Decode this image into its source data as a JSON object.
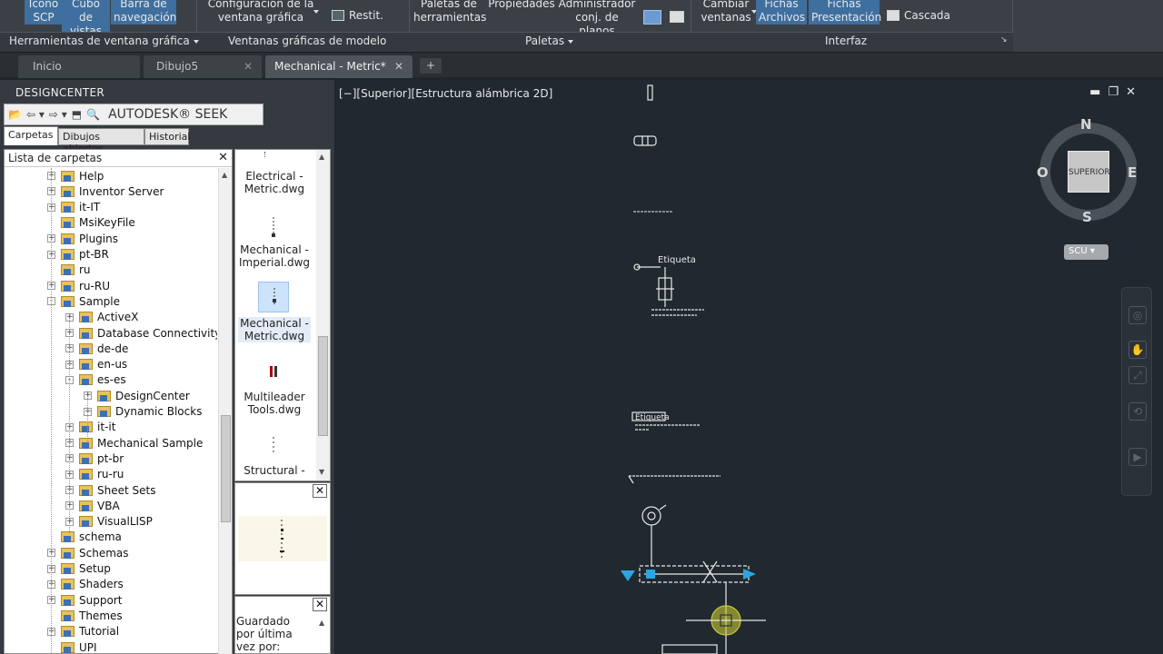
{
  "ribbon": {
    "btn_scp": "Icono SCP",
    "btn_cubo": "Cubo de vistas",
    "btn_barra": "Barra de navegación",
    "btn_config": "Configuración de la ventana gráfica",
    "btn_restit": "Restit.",
    "btn_paletas": "Paletas de herramientas",
    "btn_propiedades": "Propiedades",
    "btn_admin": "Administrador conj. de planos",
    "btn_cambiar": "Cambiar ventanas",
    "btn_fichas_archivos": "Fichas Archivos",
    "btn_fichas_presentacion": "Fichas Presentación",
    "btn_cascada": "Cascada",
    "panel_herramientas": "Herramientas de ventana gráfica",
    "panel_ventanas": "Ventanas gráficas de modelo",
    "panel_paletas": "Paletas",
    "panel_interfaz": "Interfaz"
  },
  "file_tabs": [
    {
      "label": "Inicio"
    },
    {
      "label": "Dibujo5"
    },
    {
      "label": "Mechanical - Metric*"
    }
  ],
  "designcenter": {
    "title": "DESIGNCENTER",
    "seek_label": "AUTODESK® SEEK",
    "tabs": [
      "Carpetas",
      "Dibujos abiertos",
      "Historial"
    ],
    "folder_header": "Lista de carpetas",
    "tree": [
      {
        "label": "Help",
        "level": 0,
        "expand": "+"
      },
      {
        "label": "Inventor Server",
        "level": 0,
        "expand": "+"
      },
      {
        "label": "it-IT",
        "level": 0,
        "expand": "+"
      },
      {
        "label": "MsiKeyFile",
        "level": 0,
        "expand": ""
      },
      {
        "label": "Plugins",
        "level": 0,
        "expand": "+"
      },
      {
        "label": "pt-BR",
        "level": 0,
        "expand": "+"
      },
      {
        "label": "ru",
        "level": 0,
        "expand": ""
      },
      {
        "label": "ru-RU",
        "level": 0,
        "expand": "+"
      },
      {
        "label": "Sample",
        "level": 0,
        "expand": "-"
      },
      {
        "label": "ActiveX",
        "level": 1,
        "expand": "+"
      },
      {
        "label": "Database Connectivity",
        "level": 1,
        "expand": "+"
      },
      {
        "label": "de-de",
        "level": 1,
        "expand": "+"
      },
      {
        "label": "en-us",
        "level": 1,
        "expand": "+"
      },
      {
        "label": "es-es",
        "level": 1,
        "expand": "-"
      },
      {
        "label": "DesignCenter",
        "level": 2,
        "expand": "+"
      },
      {
        "label": "Dynamic Blocks",
        "level": 2,
        "expand": "+"
      },
      {
        "label": "it-it",
        "level": 1,
        "expand": "+"
      },
      {
        "label": "Mechanical Sample",
        "level": 1,
        "expand": "+"
      },
      {
        "label": "pt-br",
        "level": 1,
        "expand": "+"
      },
      {
        "label": "ru-ru",
        "level": 1,
        "expand": "+"
      },
      {
        "label": "Sheet Sets",
        "level": 1,
        "expand": "+"
      },
      {
        "label": "VBA",
        "level": 1,
        "expand": "+"
      },
      {
        "label": "VisualLISP",
        "level": 1,
        "expand": "+"
      },
      {
        "label": "schema",
        "level": 0,
        "expand": ""
      },
      {
        "label": "Schemas",
        "level": 0,
        "expand": "+"
      },
      {
        "label": "Setup",
        "level": 0,
        "expand": "+"
      },
      {
        "label": "Shaders",
        "level": 0,
        "expand": "+"
      },
      {
        "label": "Support",
        "level": 0,
        "expand": "+"
      },
      {
        "label": "Themes",
        "level": 0,
        "expand": ""
      },
      {
        "label": "Tutorial",
        "level": 0,
        "expand": "+"
      },
      {
        "label": "UPI",
        "level": 0,
        "expand": ""
      }
    ],
    "files": [
      {
        "label": "Electrical - Metric.dwg"
      },
      {
        "label": "Mechanical - Imperial.dwg"
      },
      {
        "label": "Mechanical - Metric.dwg",
        "selected": true
      },
      {
        "label": "Multileader Tools.dwg"
      },
      {
        "label": "Structural -"
      }
    ],
    "description": "Guardado por última vez por: Autodesk"
  },
  "viewport": {
    "label": "[−][Superior][Estructura alámbrica 2D]",
    "labels": {
      "etiqueta_1": "Etiqueta",
      "etiqueta_2": "Etiqueta"
    },
    "compass": {
      "n": "N",
      "s": "S",
      "e": "E",
      "o": "O",
      "cube": "SUPERIOR"
    },
    "ucs": "SCU"
  },
  "colors": {
    "accent_button": "#3f6f9e",
    "viewport_bg": "#212830",
    "grip_blue": "#2aa5e0",
    "snap_yellow": "#c8c832"
  }
}
